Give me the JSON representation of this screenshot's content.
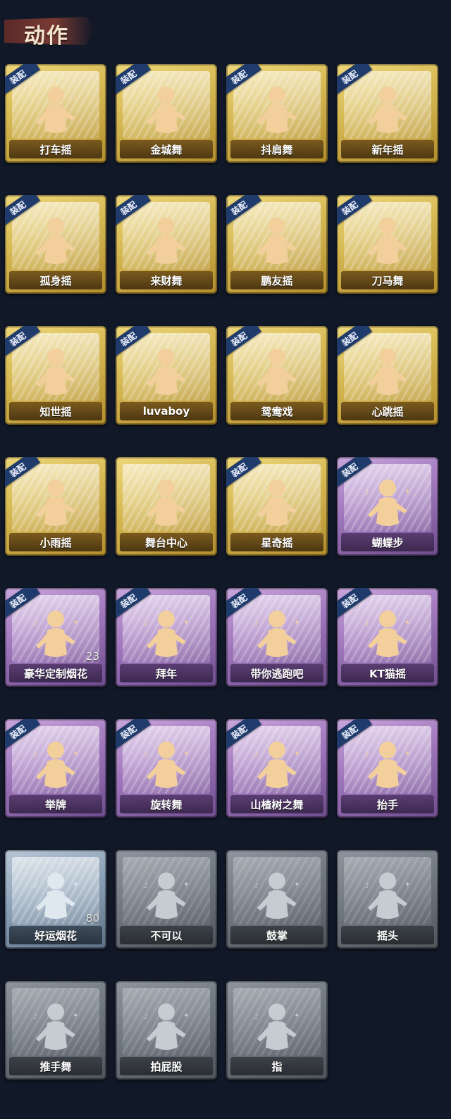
{
  "header": {
    "title": "动作"
  },
  "equip_label": "装配",
  "colors": {
    "gold": "#d7ba55",
    "purple": "#9f76bb",
    "blue": "#8aa0b6",
    "grey": "#6f7780",
    "figure": "#f2cf9b"
  },
  "cards": [
    {
      "label": "打车摇",
      "rarity": "gold",
      "equipped": true,
      "icon": "dancer-icon"
    },
    {
      "label": "金城舞",
      "rarity": "gold",
      "equipped": true,
      "icon": "dancer-icon"
    },
    {
      "label": "抖肩舞",
      "rarity": "gold",
      "equipped": true,
      "icon": "dancer-icon"
    },
    {
      "label": "新年摇",
      "rarity": "gold",
      "equipped": true,
      "icon": "dancer-icon"
    },
    {
      "label": "孤身摇",
      "rarity": "gold",
      "equipped": true,
      "icon": "dancer-icon"
    },
    {
      "label": "来财舞",
      "rarity": "gold",
      "equipped": true,
      "icon": "dancer-icon"
    },
    {
      "label": "鹏友摇",
      "rarity": "gold",
      "equipped": true,
      "icon": "dancer-icon"
    },
    {
      "label": "刀马舞",
      "rarity": "gold",
      "equipped": true,
      "icon": "dancer-icon"
    },
    {
      "label": "知世摇",
      "rarity": "gold",
      "equipped": true,
      "icon": "dancer-icon"
    },
    {
      "label": "luvaboy",
      "rarity": "gold",
      "equipped": true,
      "icon": "dancer-icon"
    },
    {
      "label": "鸳鸯戏",
      "rarity": "gold",
      "equipped": true,
      "icon": "dancer-icon"
    },
    {
      "label": "心跳摇",
      "rarity": "gold",
      "equipped": true,
      "icon": "dancer-icon"
    },
    {
      "label": "小雨摇",
      "rarity": "gold",
      "equipped": true,
      "icon": "dancer-icon"
    },
    {
      "label": "舞台中心",
      "rarity": "gold",
      "equipped": false,
      "icon": "dancer-icon"
    },
    {
      "label": "星奇摇",
      "rarity": "gold",
      "equipped": true,
      "icon": "dancer-icon"
    },
    {
      "label": "蝴蝶步",
      "rarity": "purple",
      "equipped": true,
      "icon": "dancer-icon"
    },
    {
      "label": "豪华定制烟花",
      "rarity": "purple",
      "equipped": true,
      "icon": "firework-box-icon",
      "count": "23"
    },
    {
      "label": "拜年",
      "rarity": "purple",
      "equipped": true,
      "icon": "bow-icon"
    },
    {
      "label": "带你逃跑吧",
      "rarity": "purple",
      "equipped": true,
      "icon": "dancer-icon"
    },
    {
      "label": "KT猫摇",
      "rarity": "purple",
      "equipped": true,
      "icon": "dancer-icon"
    },
    {
      "label": "举牌",
      "rarity": "purple",
      "equipped": true,
      "icon": "sign-icon"
    },
    {
      "label": "旋转舞",
      "rarity": "purple",
      "equipped": true,
      "icon": "dancer-icon"
    },
    {
      "label": "山楂树之舞",
      "rarity": "purple",
      "equipped": true,
      "icon": "dancer-icon"
    },
    {
      "label": "抬手",
      "rarity": "purple",
      "equipped": true,
      "icon": "raise-hand-icon"
    },
    {
      "label": "好运烟花",
      "rarity": "blue",
      "equipped": false,
      "icon": "firework-can-icon",
      "count": "80"
    },
    {
      "label": "不可以",
      "rarity": "grey",
      "equipped": false,
      "icon": "finger-icon"
    },
    {
      "label": "鼓掌",
      "rarity": "grey",
      "equipped": false,
      "icon": "clap-icon"
    },
    {
      "label": "摇头",
      "rarity": "grey",
      "equipped": false,
      "icon": "shake-head-icon"
    },
    {
      "label": "推手舞",
      "rarity": "grey",
      "equipped": false,
      "icon": "push-hand-icon"
    },
    {
      "label": "拍屁股",
      "rarity": "grey",
      "equipped": false,
      "icon": "slap-icon"
    },
    {
      "label": "指",
      "rarity": "grey",
      "equipped": false,
      "icon": "point-icon"
    }
  ]
}
